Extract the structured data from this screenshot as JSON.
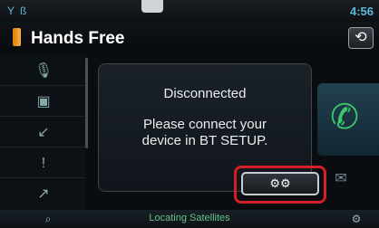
{
  "status": {
    "time": "4:56",
    "left_icons": [
      "signal-icon",
      "bluetooth-icon"
    ]
  },
  "title": {
    "text": "Hands Free",
    "back_icon": "back-arrow-icon"
  },
  "left_menu": {
    "items": [
      {
        "name": "voice-dial-icon"
      },
      {
        "name": "phonebook-icon"
      },
      {
        "name": "incoming-calls-icon"
      },
      {
        "name": "missed-calls-icon"
      },
      {
        "name": "outgoing-calls-icon"
      }
    ]
  },
  "main": {
    "title": "Disconnected",
    "message_line1": "Please connect your",
    "message_line2": "device in BT SETUP.",
    "bt_setup_icon": "gears-icon"
  },
  "right": {
    "call_icon": "phone-handset-icon",
    "sms_icon": "sms-icon"
  },
  "bottom": {
    "status": "Locating Satellites",
    "left_icon": "search-icon",
    "right_icon": "settings-icon"
  }
}
